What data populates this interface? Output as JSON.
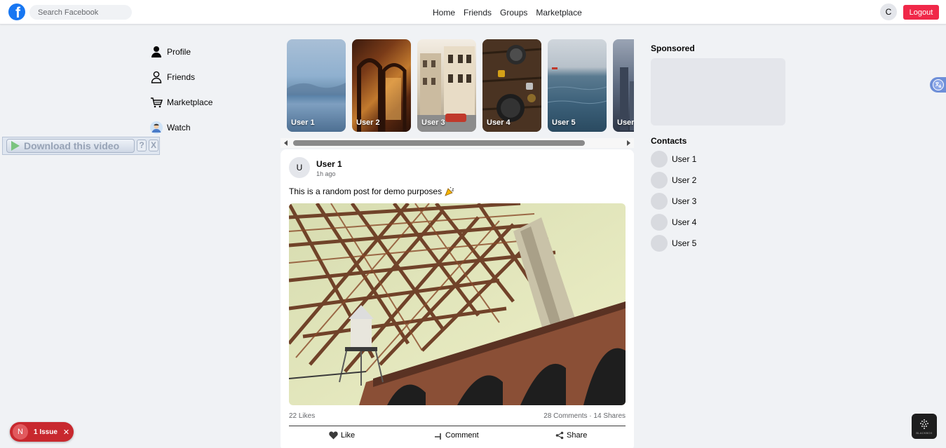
{
  "topbar": {
    "search_placeholder": "Search Facebook",
    "nav": [
      "Home",
      "Friends",
      "Groups",
      "Marketplace"
    ],
    "user_initial": "C",
    "logout_label": "Logout"
  },
  "left_nav": [
    {
      "label": "Profile",
      "icon": "person-filled-icon"
    },
    {
      "label": "Friends",
      "icon": "person-outline-icon"
    },
    {
      "label": "Marketplace",
      "icon": "shopping-cart-icon"
    },
    {
      "label": "Watch",
      "icon": "avatar-photo-icon"
    }
  ],
  "download_bar": {
    "label": "Download this video",
    "help": "?",
    "close": "X"
  },
  "stories": [
    {
      "label": "User 1"
    },
    {
      "label": "User 2"
    },
    {
      "label": "User 3"
    },
    {
      "label": "User 4"
    },
    {
      "label": "User 5"
    },
    {
      "label": "User"
    }
  ],
  "post": {
    "avatar_initial": "U",
    "author": "User 1",
    "time": "1h ago",
    "text": "This is a random post for demo purposes",
    "likes": "22 Likes",
    "comments_shares": "28 Comments · 14 Shares",
    "actions": {
      "like": "Like",
      "comment": "Comment",
      "share": "Share"
    }
  },
  "right": {
    "sponsored_title": "Sponsored",
    "contacts_title": "Contacts",
    "contacts": [
      "User 1",
      "User 2",
      "User 3",
      "User 4",
      "User 5"
    ]
  },
  "issue_badge": {
    "initial": "N",
    "label": "1 Issue",
    "close": "✕"
  },
  "blackbox_label": "BLACKBOX",
  "colors": {
    "brand": "#1877f2",
    "logout": "#f02849",
    "background": "#f0f2f5"
  }
}
